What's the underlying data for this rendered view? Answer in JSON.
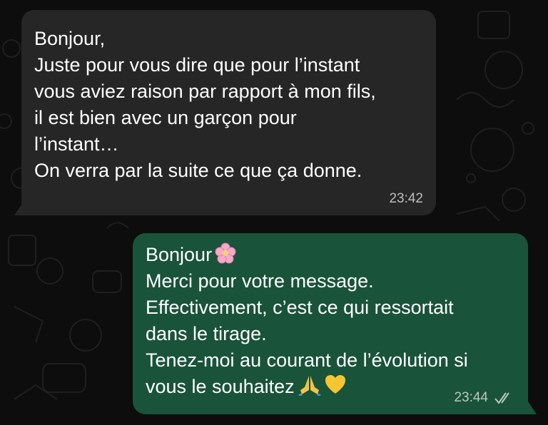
{
  "messages": {
    "incoming": {
      "lines": [
        "Bonjour,",
        "Juste pour vous dire que pour l’instant",
        "vous aviez raison par rapport à mon fils,",
        "il est bien avec un garçon pour",
        "l’instant…",
        "On verra par la suite ce que ça donne."
      ],
      "time": "23:42"
    },
    "outgoing": {
      "lines": [
        "Bonjour",
        "Merci pour votre message.",
        "Effectivement, c’est ce qui ressortait",
        "dans le tirage.",
        "Tenez-moi au courant de l’évolution si",
        "vous le souhaitez"
      ],
      "time": "23:44",
      "status": "read",
      "emojis": [
        "cherry-blossom-icon",
        "folded-hands-icon",
        "yellow-heart-icon"
      ]
    }
  },
  "colors": {
    "background": "#0d0d0d",
    "incoming_bubble": "#262626",
    "outgoing_bubble": "#19533a"
  }
}
